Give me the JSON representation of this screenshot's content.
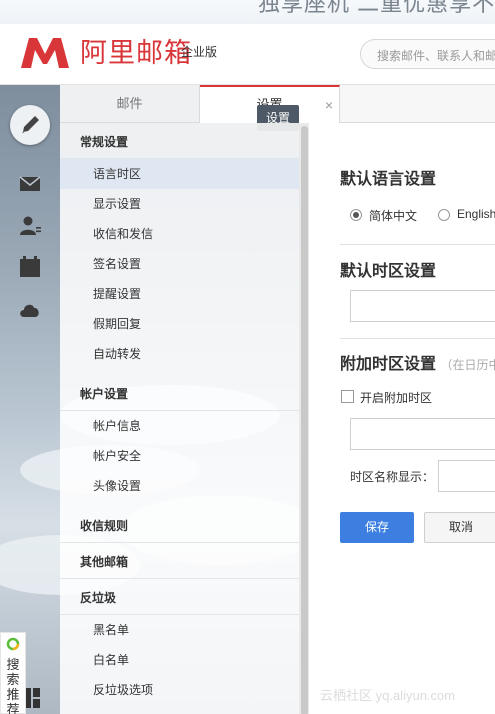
{
  "banner": {
    "text": "独享座机 二重优惠享不停"
  },
  "header": {
    "logo_text": "阿里邮箱",
    "edition": "企业版",
    "search_placeholder": "搜索邮件、联系人和邮"
  },
  "tabs": {
    "mail": "邮件",
    "settings": "设置",
    "close": "×"
  },
  "tooltip": "设置",
  "menu": [
    {
      "type": "cat",
      "label": "常规设置"
    },
    {
      "type": "item",
      "label": "语言时区",
      "active": true
    },
    {
      "type": "item",
      "label": "显示设置"
    },
    {
      "type": "item",
      "label": "收信和发信"
    },
    {
      "type": "item",
      "label": "签名设置"
    },
    {
      "type": "item",
      "label": "提醒设置"
    },
    {
      "type": "item",
      "label": "假期回复"
    },
    {
      "type": "item",
      "label": "自动转发"
    },
    {
      "type": "cat",
      "label": "帐户设置"
    },
    {
      "type": "item",
      "label": "帐户信息"
    },
    {
      "type": "item",
      "label": "帐户安全"
    },
    {
      "type": "item",
      "label": "头像设置"
    },
    {
      "type": "cat",
      "label": "收信规则"
    },
    {
      "type": "cat",
      "label": "其他邮箱"
    },
    {
      "type": "cat",
      "label": "反垃圾"
    },
    {
      "type": "item",
      "label": "黑名单"
    },
    {
      "type": "item",
      "label": "白名单"
    },
    {
      "type": "item",
      "label": "反垃圾选项"
    }
  ],
  "content": {
    "language_title": "默认语言设置",
    "lang_simplified": "简体中文",
    "lang_english": "English",
    "timezone_title": "默认时区设置",
    "extra_tz_title": "附加时区设置",
    "extra_tz_hint": "（在日历中",
    "enable_extra_tz": "开启附加时区",
    "tz_name_label": "时区名称显示：",
    "save": "保存",
    "cancel": "取消"
  },
  "rail": {
    "search_rec": "搜索推荐"
  },
  "watermark": "云栖社区 yq.aliyun.com",
  "colors": {
    "brand_red": "#d9363a",
    "primary_blue": "#3c7fe0"
  }
}
